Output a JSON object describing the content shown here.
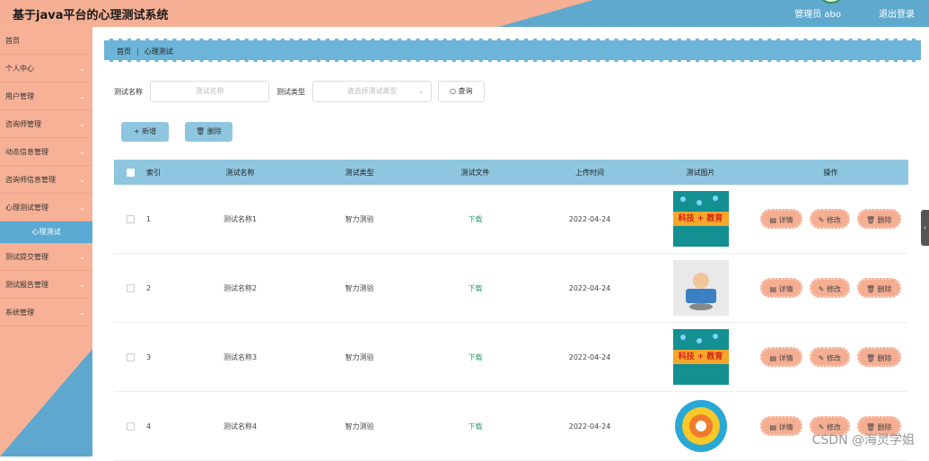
{
  "header": {
    "title": "基于java平台的心理测试系统",
    "admin_label": "管理员 abo",
    "logout_label": "退出登录"
  },
  "sidebar": {
    "items": [
      {
        "label": "首页",
        "has_arrow": false
      },
      {
        "label": "个人中心",
        "has_arrow": true
      },
      {
        "label": "用户管理",
        "has_arrow": true
      },
      {
        "label": "咨询师管理",
        "has_arrow": true
      },
      {
        "label": "动态信息管理",
        "has_arrow": true
      },
      {
        "label": "咨询师信息管理",
        "has_arrow": true
      },
      {
        "label": "心理测试管理",
        "has_arrow": true
      },
      {
        "label": "测试提交管理",
        "has_arrow": true
      },
      {
        "label": "测试报告管理",
        "has_arrow": true
      },
      {
        "label": "系统管理",
        "has_arrow": true
      }
    ],
    "active_sub": "心理测试",
    "arrow_glyph": "⌄"
  },
  "breadcrumb": {
    "home": "首页",
    "separator": "|",
    "current": "心理测试"
  },
  "search": {
    "name_label": "测试名称",
    "name_placeholder": "测试名称",
    "type_label": "测试类型",
    "type_placeholder": "请选择测试类型",
    "query_label": "查询"
  },
  "actions": {
    "add_label": "+ 新增",
    "delete_label": "删除"
  },
  "table": {
    "columns": [
      "索引",
      "测试名称",
      "测试类型",
      "测试文件",
      "上传时间",
      "测试图片",
      "操作"
    ],
    "rows": [
      {
        "index": "1",
        "name": "测试名称1",
        "type": "智力测验",
        "file": "下载",
        "time": "2022-04-24",
        "image": "tech-education"
      },
      {
        "index": "2",
        "name": "测试名称2",
        "type": "智力测验",
        "file": "下载",
        "time": "2022-04-24",
        "image": "student-desk"
      },
      {
        "index": "3",
        "name": "测试名称3",
        "type": "智力测验",
        "file": "下载",
        "time": "2022-04-24",
        "image": "tech-education"
      },
      {
        "index": "4",
        "name": "测试名称4",
        "type": "智力测验",
        "file": "下载",
        "time": "2022-04-24",
        "image": "target"
      }
    ],
    "ops": {
      "detail": "详情",
      "edit": "修改",
      "delete": "删除"
    },
    "tech_band_text": "科技 + 教育"
  },
  "watermark": "CSDN @海灵学姐",
  "colors": {
    "header_peach": "#f6b096",
    "header_blue": "#5fa9cf",
    "sidebar_peach": "#f7b196",
    "active_blue": "#5aaad4",
    "table_head": "#8ec6e0",
    "op_button": "#f5ae92",
    "download_green": "#2a9d6a"
  }
}
